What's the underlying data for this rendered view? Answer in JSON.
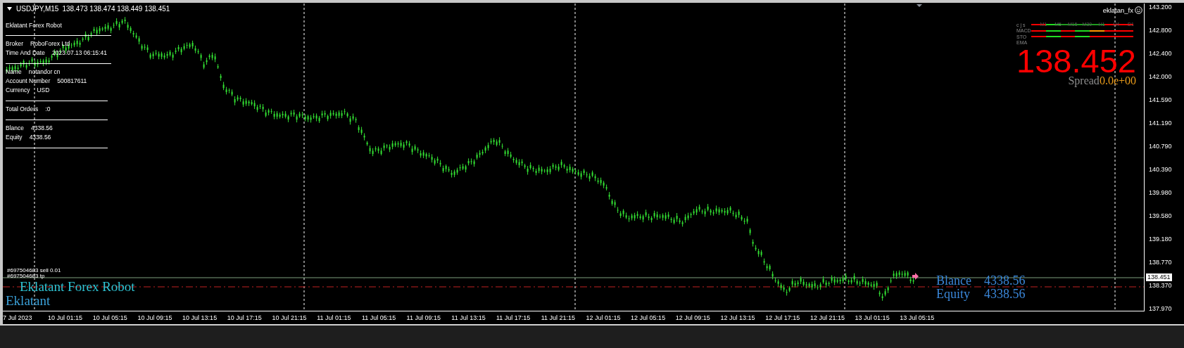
{
  "chart_header": {
    "symbol": "USDJPY,M15",
    "ohlc": "138.473 138.474 138.449 138.451"
  },
  "info_panel": {
    "title": "Eklatant Forex Robot",
    "groups": [
      [
        {
          "label": "Broker",
          "value": "RoboForex Ltd"
        },
        {
          "label": "Time And Date",
          "value": "2023.07.13 06:15:41"
        }
      ],
      [
        {
          "label": "Name",
          "value": "notandor cn"
        },
        {
          "label": "Account Number",
          "value": "500817611"
        },
        {
          "label": "Currency",
          "value": "USD"
        }
      ],
      [
        {
          "label": "Total Orders",
          "value": ":0"
        }
      ],
      [
        {
          "label": "Blance",
          "value": "4338.56"
        },
        {
          "label": "Equity",
          "value": "4338.56"
        }
      ]
    ]
  },
  "account_tag": "eklatan_fx",
  "signal_panel": {
    "timeframes": [
      "M1",
      "M5",
      "M15",
      "M30",
      "H1",
      "H4",
      "D1"
    ],
    "rows": [
      {
        "label": "c j s",
        "segments": [
          {
            "color": "#ff0000"
          },
          {
            "color": "#22dd22"
          },
          {
            "color": "#1f9a1f"
          },
          {
            "color": "#1f9a1f"
          },
          {
            "color": "#1f9a1f"
          },
          {
            "color": "#ff0000"
          },
          {
            "color": "#ff0000"
          }
        ]
      },
      {
        "label": "MACD",
        "segments": [
          {
            "color": "#ff0000"
          },
          {
            "color": "#22dd22"
          },
          {
            "color": "#ff0000"
          },
          {
            "color": "#22dd22"
          },
          {
            "color": "#ff9900"
          },
          {
            "color": "#ff0000"
          },
          {
            "color": "#ff0000"
          }
        ]
      },
      {
        "label": "STO",
        "segments": [
          {
            "color": "#ff0000"
          },
          {
            "color": "#22dd22"
          },
          {
            "color": "#ff0000"
          },
          {
            "color": "#22dd22"
          },
          {
            "color": "#ff0000"
          },
          {
            "color": "#ff0000"
          },
          {
            "color": "#ff0000"
          }
        ]
      },
      {
        "label": "EMA"
      }
    ]
  },
  "price_display": {
    "price": "138.452",
    "spread_label": "Spread",
    "spread_value": "0.0e+00"
  },
  "order_labels": [
    "#697504683 sell 0.01",
    "#697504683 tp"
  ],
  "robot_labels": [
    "Eklatant Forex Robot",
    "Eklatant"
  ],
  "account_summary": [
    {
      "label": "Blance",
      "value": "4338.56"
    },
    {
      "label": "Equity",
      "value": "4338.56"
    }
  ],
  "price_axis": [
    "143.200",
    "142.800",
    "142.400",
    "142.000",
    "141.590",
    "141.190",
    "140.790",
    "140.390",
    "139.980",
    "139.580",
    "139.180",
    "138.770",
    "138.370",
    "137.970"
  ],
  "current_price": "138.451",
  "time_axis": [
    "7 Jul 2023",
    "10 Jul 01:15",
    "10 Jul 05:15",
    "10 Jul 09:15",
    "10 Jul 13:15",
    "10 Jul 17:15",
    "10 Jul 21:15",
    "11 Jul 01:15",
    "11 Jul 05:15",
    "11 Jul 09:15",
    "11 Jul 13:15",
    "11 Jul 17:15",
    "11 Jul 21:15",
    "12 Jul 01:15",
    "12 Jul 05:15",
    "12 Jul 09:15",
    "12 Jul 13:15",
    "12 Jul 17:15",
    "12 Jul 21:15",
    "13 Jul 01:15",
    "13 Jul 05:15"
  ]
}
